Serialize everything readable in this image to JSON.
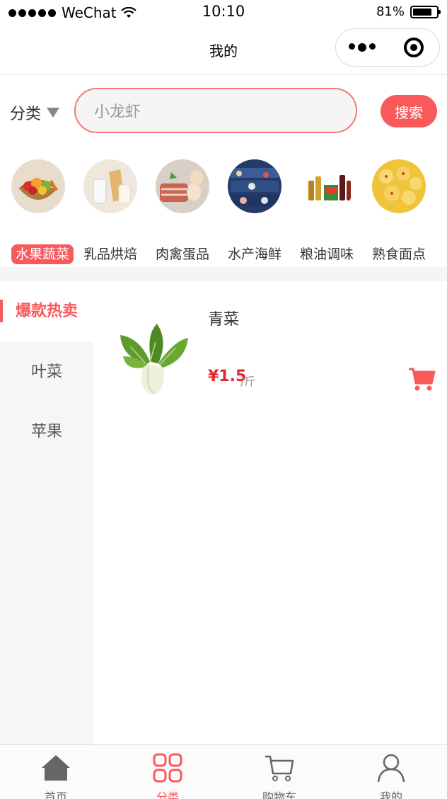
{
  "status_bar": {
    "carrier": "WeChat",
    "time": "10:10",
    "battery": "81%",
    "battery_level": 0.81
  },
  "nav": {
    "title": "我的"
  },
  "search": {
    "category_label": "分类",
    "placeholder": "小龙虾",
    "button_label": "搜索"
  },
  "categories": [
    {
      "label": "水果蔬菜",
      "icon": "fruit-basket-icon",
      "active": true
    },
    {
      "label": "乳品烘焙",
      "icon": "dairy-bread-icon",
      "active": false
    },
    {
      "label": "肉禽蛋品",
      "icon": "meat-eggs-icon",
      "active": false
    },
    {
      "label": "水产海鲜",
      "icon": "seafood-icon",
      "active": false
    },
    {
      "label": "粮油调味",
      "icon": "oil-seasoning-icon",
      "active": false
    },
    {
      "label": "熟食面点",
      "icon": "dim-sum-icon",
      "active": false
    }
  ],
  "sidebar": {
    "items": [
      {
        "label": "爆款热卖",
        "active": true
      },
      {
        "label": "叶菜",
        "active": false
      },
      {
        "label": "苹果",
        "active": false
      }
    ]
  },
  "products": [
    {
      "name": "青菜",
      "price": "¥1.5",
      "unit": "/斤",
      "image": "bok-choy-icon",
      "cart_icon": "cart-icon"
    }
  ],
  "tab_bar": {
    "tabs": [
      {
        "label": "首页",
        "icon": "home-icon",
        "active": false
      },
      {
        "label": "分类",
        "icon": "category-grid-icon",
        "active": true
      },
      {
        "label": "购物车",
        "icon": "cart-icon",
        "active": false
      },
      {
        "label": "我的",
        "icon": "user-icon",
        "active": false
      }
    ]
  },
  "colors": {
    "accent": "#f85a5c",
    "price": "#e8232d",
    "sidebar_bg": "#f6f6f6"
  }
}
